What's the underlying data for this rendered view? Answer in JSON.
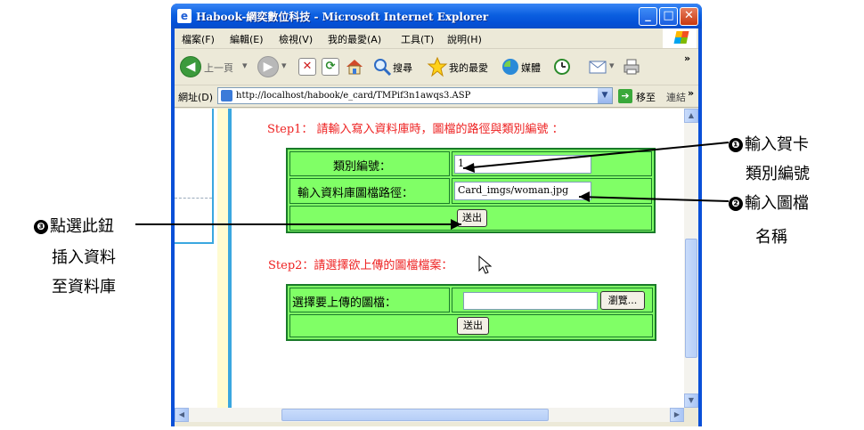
{
  "window": {
    "title": "Habook-網奕數位科技 - Microsoft Internet Explorer",
    "controls": {
      "minimize": "_",
      "maximize": "□",
      "close": "✕"
    }
  },
  "menubar": {
    "items": [
      "檔案(F)",
      "編輯(E)",
      "檢視(V)",
      "我的最愛(A)",
      "工具(T)",
      "說明(H)"
    ]
  },
  "toolbar": {
    "back_label": "上一頁",
    "search_label": "搜尋",
    "favorites_label": "我的最愛",
    "media_label": "媒體"
  },
  "addressbar": {
    "label": "網址(D)",
    "url": "http://localhost/habook/e_card/TMPif3n1awqs3.ASP",
    "go_label": "移至",
    "links_label": "連結"
  },
  "page": {
    "step1": "Step1： 請輸入寫入資料庫時，圖檔的路徑與類別編號 ：",
    "form1": {
      "category_label": "類別編號：",
      "category_value": "1",
      "path_label": "輸入資料庫圖檔路徑：",
      "path_value": "Card_imgs/woman.jpg",
      "submit_label": "送出"
    },
    "step2": "Step2：請選擇欲上傳的圖檔檔案：",
    "form2": {
      "file_label": "選擇要上傳的圖檔：",
      "file_value": "",
      "browse_label": "瀏覽...",
      "submit_label": "送出"
    }
  },
  "annotations": {
    "note1": {
      "num": "❶",
      "line1": "輸入賀卡",
      "line2": "類別編號"
    },
    "note2": {
      "num": "❷",
      "line1": "輸入圖檔",
      "line2": "名稱"
    },
    "note3": {
      "num": "❸",
      "line1": "點選此鈕",
      "line2": "插入資料",
      "line3": "至資料庫"
    }
  },
  "colors": {
    "titlebar": "#0b5fe0",
    "form_bg": "#80ff66",
    "form_border": "#1a7a2a",
    "step_text": "#ee2222",
    "frame_blue": "#3aa7e0"
  },
  "icons": [
    "ie-icon",
    "back-icon",
    "forward-icon",
    "stop-icon",
    "refresh-icon",
    "home-icon",
    "search-icon",
    "favorites-icon",
    "media-icon",
    "history-icon",
    "mail-icon",
    "print-icon",
    "go-icon",
    "windows-logo-icon"
  ]
}
